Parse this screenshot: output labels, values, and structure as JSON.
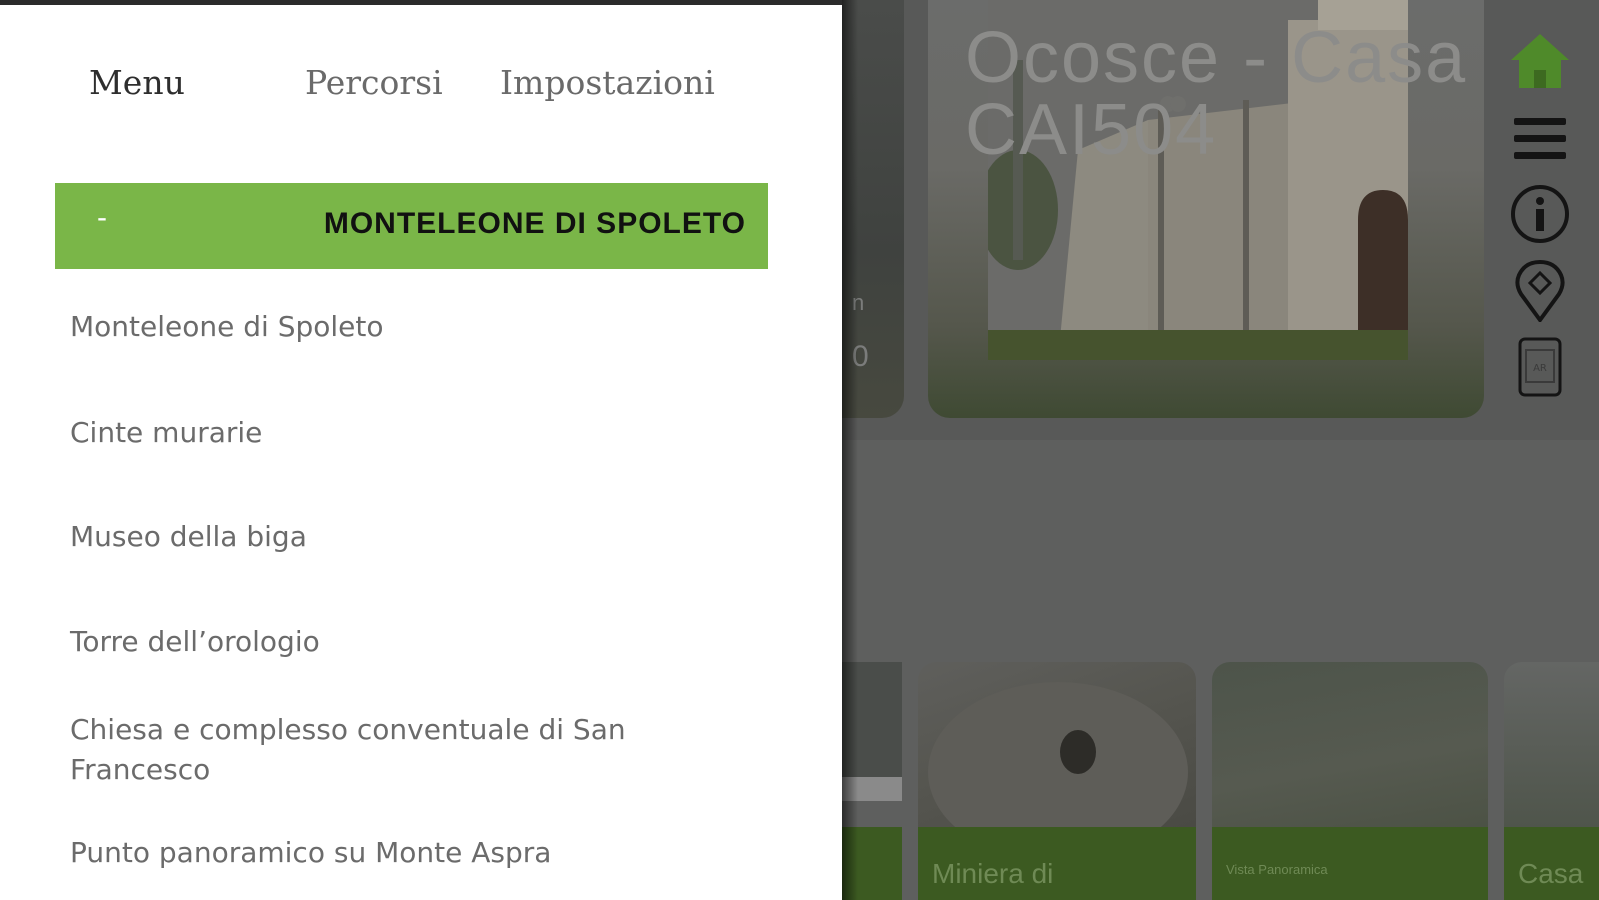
{
  "background_app": {
    "hero_title_line1": "Ocosce - Casa",
    "hero_title_line2": "CAI504",
    "side_rail_icons": [
      "home-icon",
      "hamburger-menu-icon",
      "info-icon",
      "map-pin-icon",
      "ar-icon"
    ],
    "cards": [
      {
        "caption": "Miniera di"
      },
      {
        "caption": "Vista Panoramica"
      },
      {
        "caption": "Casa"
      }
    ],
    "colors": {
      "overlay": "#5e5f5e",
      "home_icon": "#4f8a2a",
      "card_bar": "#3c5a21"
    }
  },
  "drawer": {
    "tabs": [
      {
        "label": "Menu",
        "active": true
      },
      {
        "label": "Percorsi",
        "active": false
      },
      {
        "label": "Impostazioni",
        "active": false
      }
    ],
    "section": {
      "collapse_symbol": "-",
      "title": "MONTELEONE DI SPOLETO",
      "color": "#7ab648"
    },
    "items": [
      {
        "label": "Monteleone di Spoleto"
      },
      {
        "label": "Cinte murarie"
      },
      {
        "label": "Museo della biga"
      },
      {
        "label": "Torre dell’orologio"
      },
      {
        "label": "Chiesa e complesso conventuale di San Francesco"
      },
      {
        "label": "Punto panoramico su Monte Aspra"
      }
    ]
  }
}
